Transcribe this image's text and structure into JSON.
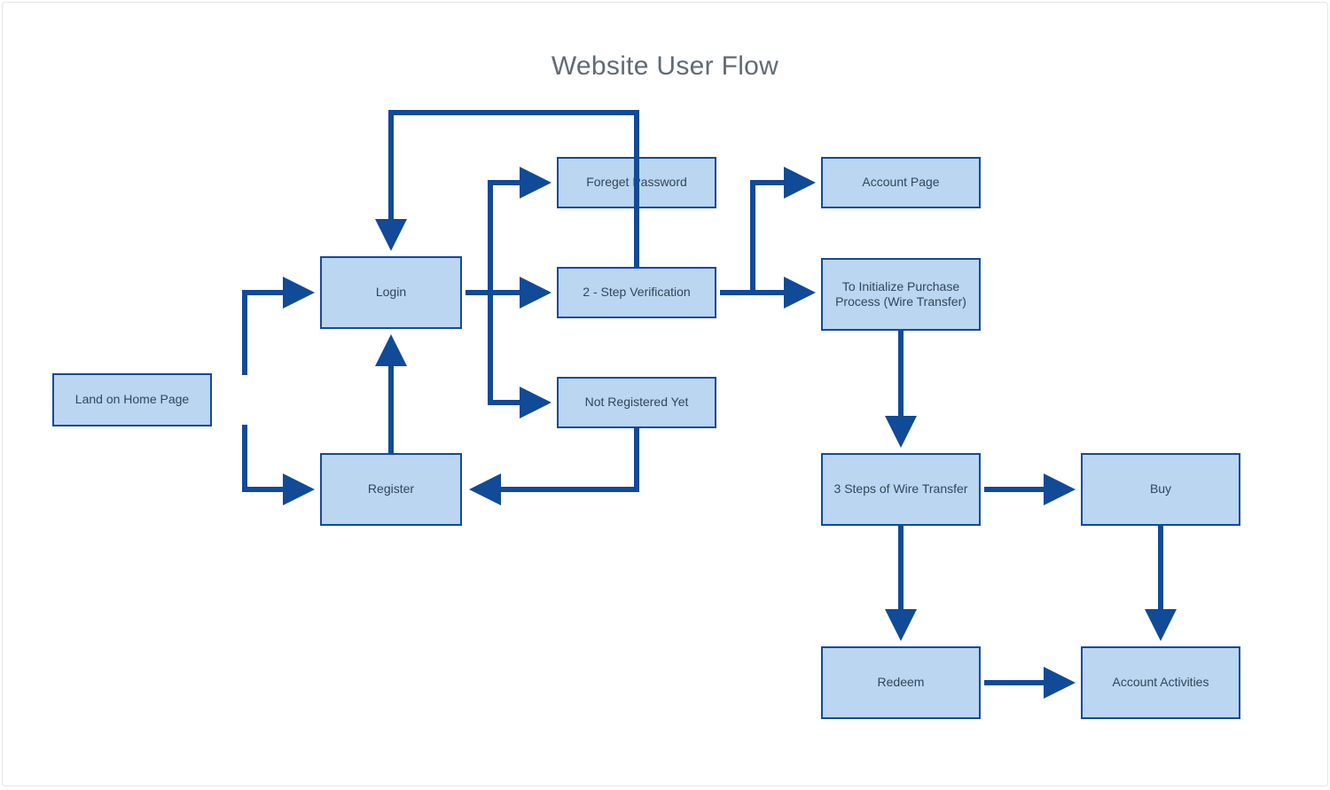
{
  "title": "Website User Flow",
  "colors": {
    "node_fill": "#bbd6f1",
    "node_border": "#134a99",
    "arrow": "#114a97",
    "title": "#5f6b76"
  },
  "nodes": {
    "home": {
      "label": "Land on Home Page"
    },
    "login": {
      "label": "Login"
    },
    "register": {
      "label": "Register"
    },
    "forget": {
      "label": "Foreget Password"
    },
    "twostep": {
      "label": "2 - Step Verification"
    },
    "notreg": {
      "label": "Not Registered Yet"
    },
    "account": {
      "label": "Account Page"
    },
    "initpurchase": {
      "label": "To Initialize Purchase Process (Wire Transfer)"
    },
    "threesteps": {
      "label": "3 Steps of Wire Transfer"
    },
    "buy": {
      "label": "Buy"
    },
    "redeem": {
      "label": "Redeem"
    },
    "activities": {
      "label": "Account Activities"
    }
  },
  "flows": [
    {
      "from": "home",
      "to": "login"
    },
    {
      "from": "home",
      "to": "register"
    },
    {
      "from": "register",
      "to": "login"
    },
    {
      "from": "login",
      "to": "twostep"
    },
    {
      "from": "login",
      "to": "forget"
    },
    {
      "from": "login",
      "to": "notreg"
    },
    {
      "from": "notreg",
      "to": "register"
    },
    {
      "from": "twostep",
      "to": "login"
    },
    {
      "from": "twostep",
      "to": "account"
    },
    {
      "from": "twostep",
      "to": "initpurchase"
    },
    {
      "from": "initpurchase",
      "to": "threesteps"
    },
    {
      "from": "threesteps",
      "to": "buy"
    },
    {
      "from": "threesteps",
      "to": "redeem"
    },
    {
      "from": "buy",
      "to": "activities"
    },
    {
      "from": "redeem",
      "to": "activities"
    }
  ]
}
